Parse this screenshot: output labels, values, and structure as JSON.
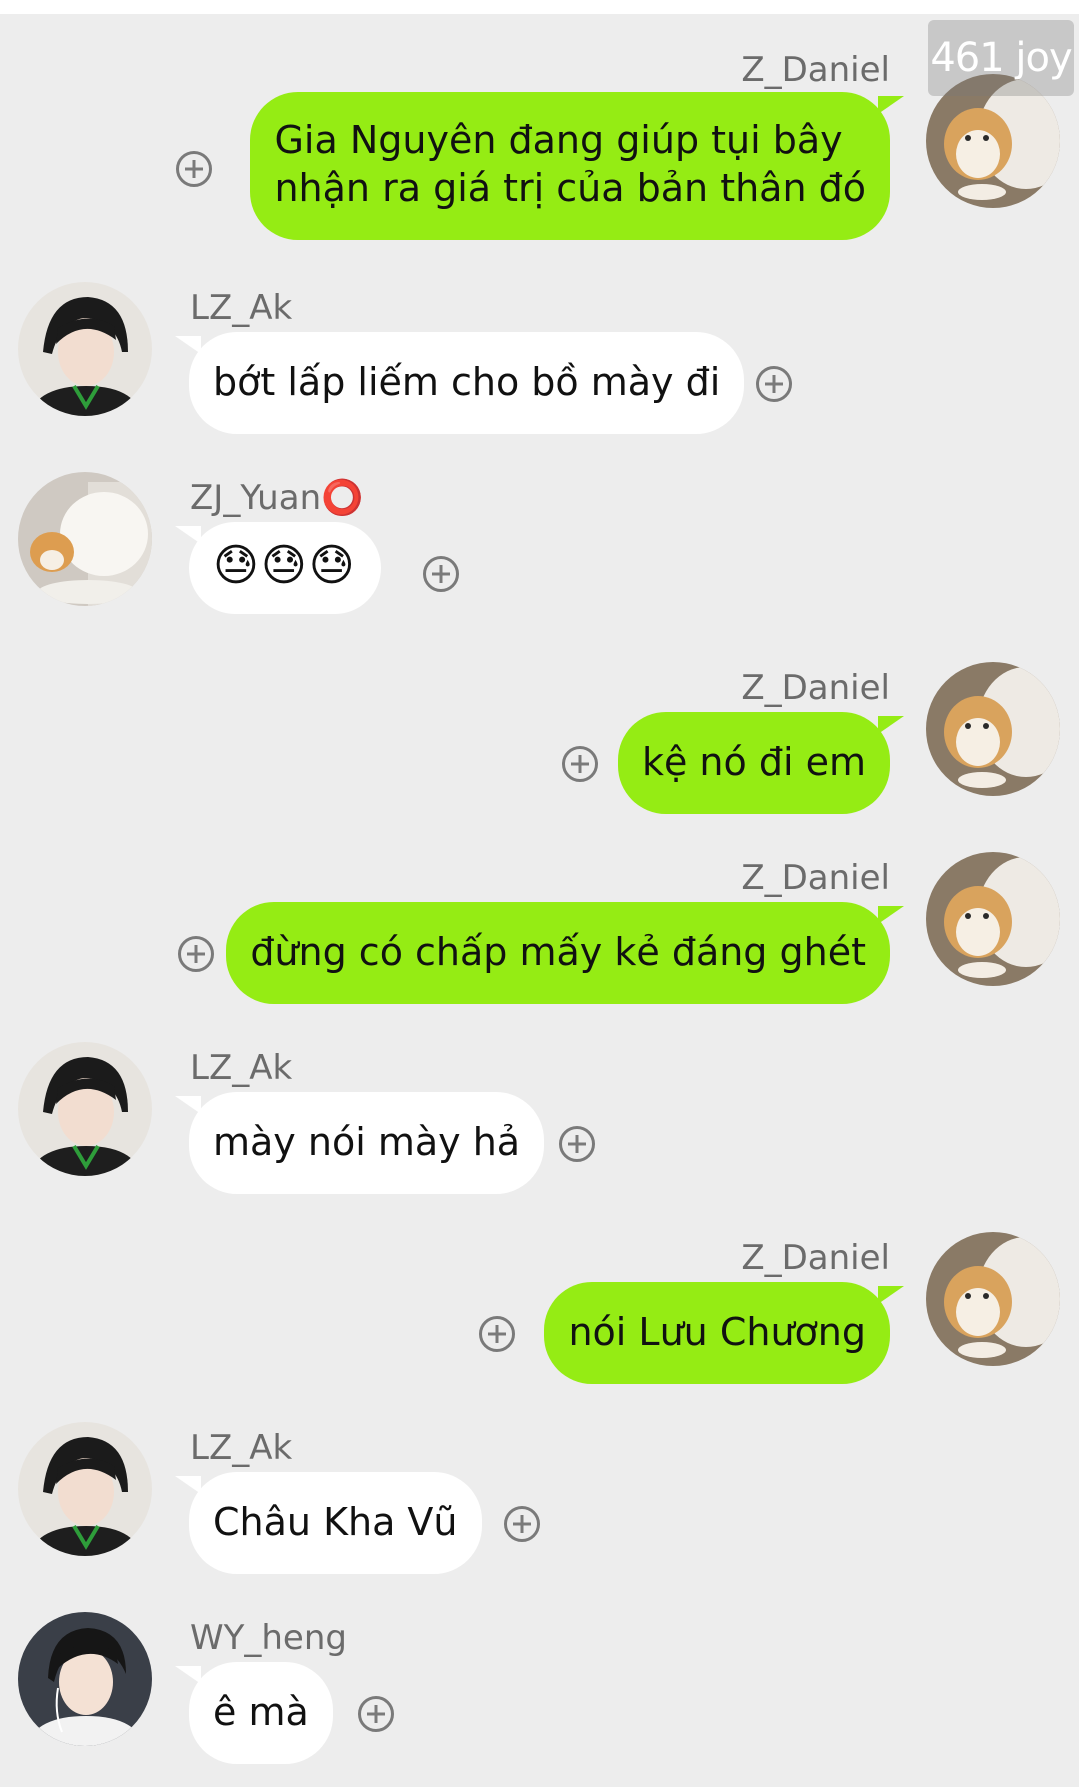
{
  "watermark": "461 joy",
  "colors": {
    "background": "#ededed",
    "outgoing_bubble": "#95ec14",
    "incoming_bubble": "#ffffff",
    "name_text": "#6b6b6b"
  },
  "messages": [
    {
      "side": "right",
      "sender": "Z_Daniel",
      "text_lines": [
        "Gia Nguyên đang giúp tụi bây",
        "nhận ra giá trị của bản thân đó"
      ],
      "avatar": "cat-avatar"
    },
    {
      "side": "left",
      "sender": "LZ_Ak",
      "text": "bớt lấp liếm cho bồ mày đi",
      "avatar": "person-dark-hair-avatar"
    },
    {
      "side": "left",
      "sender": "ZJ_Yuan⭕",
      "text": "😓😓😓",
      "avatar": "cat-white-avatar"
    },
    {
      "side": "right",
      "sender": "Z_Daniel",
      "text": "kệ nó đi em",
      "avatar": "cat-avatar"
    },
    {
      "side": "right",
      "sender": "Z_Daniel",
      "text": "đừng có chấp mấy kẻ đáng ghét",
      "avatar": "cat-avatar"
    },
    {
      "side": "left",
      "sender": "LZ_Ak",
      "text": "mày nói mày hả",
      "avatar": "person-dark-hair-avatar"
    },
    {
      "side": "right",
      "sender": "Z_Daniel",
      "text": "nói Lưu Chương",
      "avatar": "cat-avatar"
    },
    {
      "side": "left",
      "sender": "LZ_Ak",
      "text": "Châu Kha Vũ",
      "avatar": "person-dark-hair-avatar"
    },
    {
      "side": "left",
      "sender": "WY_heng",
      "text": "ê mà",
      "avatar": "person-earphones-avatar"
    }
  ],
  "icons": {
    "add_reaction": "plus-circle-icon"
  }
}
